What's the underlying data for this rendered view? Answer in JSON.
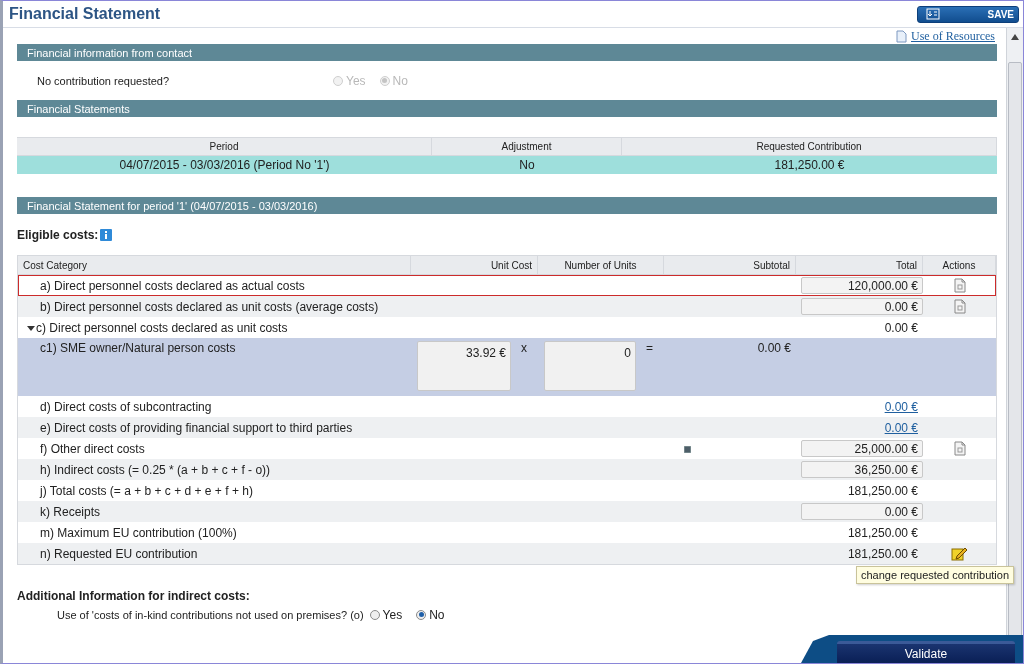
{
  "window": {
    "title": "Financial Statement"
  },
  "save_button": "SAVE",
  "resources_link": "Use of Resources",
  "contact_section": {
    "title": "Financial information from contact",
    "question": "No contribution requested?",
    "disabled": true,
    "options": [
      {
        "label": "Yes",
        "selected": false
      },
      {
        "label": "No",
        "selected": true
      }
    ]
  },
  "statements_section": {
    "title": "Financial Statements",
    "columns": [
      "Period",
      "Adjustment",
      "Requested Contribution"
    ],
    "rows": [
      {
        "cells": [
          "04/07/2015 - 03/03/2016 (Period No '1')",
          "No",
          "181,250.00 €"
        ],
        "selected": true
      }
    ]
  },
  "period_section": {
    "title": "Financial Statement for period '1' (04/07/2015 - 03/03/2016)",
    "eligible_label": "Eligible costs:"
  },
  "cost_table": {
    "columns": [
      "Cost Category",
      "Unit Cost",
      "Number of Units",
      "Subtotal",
      "Total",
      "Actions"
    ],
    "rows": [
      {
        "kind": "item",
        "label": "a) Direct personnel costs declared as actual costs",
        "total": {
          "kind": "field",
          "value": "120,000.00 €"
        },
        "action": {
          "kind": "document"
        },
        "highlighted": true
      },
      {
        "kind": "item",
        "label": "b) Direct personnel costs declared as unit costs (average costs)",
        "total": {
          "kind": "field",
          "value": "0.00 €"
        },
        "action": {
          "kind": "document"
        },
        "highlighted": false
      },
      {
        "kind": "group",
        "label": "c) Direct personnel costs declared as unit costs",
        "expanded": true,
        "total": {
          "kind": "text",
          "value": "0.00 €"
        }
      },
      {
        "kind": "unit",
        "label": "c1) SME owner/Natural person costs",
        "unit_cost": "33.92 €",
        "times": "x",
        "units": "0",
        "equals": "=",
        "subtotal": "0.00 €"
      },
      {
        "kind": "item",
        "label": "d) Direct costs of subcontracting",
        "total": {
          "kind": "link",
          "value": "0.00 €"
        },
        "highlighted": false
      },
      {
        "kind": "item",
        "label": "e) Direct costs of providing financial support to third parties",
        "total": {
          "kind": "link",
          "value": "0.00 €"
        },
        "highlighted": false
      },
      {
        "kind": "item",
        "label": "f) Other direct costs",
        "marker": true,
        "total": {
          "kind": "field",
          "value": "25,000.00 €"
        },
        "action": {
          "kind": "document"
        },
        "highlighted": false
      },
      {
        "kind": "item",
        "label": "h) Indirect costs (= 0.25 * (a + b + c + f - o))",
        "total": {
          "kind": "field",
          "value": "36,250.00 €"
        },
        "highlighted": false
      },
      {
        "kind": "item",
        "label": "j) Total costs (= a + b + c + d + e + f + h)",
        "total": {
          "kind": "text",
          "value": "181,250.00 €"
        },
        "highlighted": false
      },
      {
        "kind": "item",
        "label": "k) Receipts",
        "total": {
          "kind": "field",
          "value": "0.00 €"
        },
        "highlighted": false
      },
      {
        "kind": "item",
        "label": "m) Maximum EU contribution (100%)",
        "total": {
          "kind": "text",
          "value": "181,250.00 €"
        },
        "highlighted": false
      },
      {
        "kind": "item",
        "label": "n) Requested EU contribution",
        "total": {
          "kind": "text",
          "value": "181,250.00 €"
        },
        "action": {
          "kind": "edit"
        },
        "tooltip": "change requested contribution",
        "highlighted": false
      }
    ]
  },
  "additional": {
    "title": "Additional Information for indirect costs:",
    "question": "Use of 'costs of in-kind contributions not used on premises? (o)",
    "disabled": false,
    "options": [
      {
        "label": "Yes",
        "selected": false
      },
      {
        "label": "No",
        "selected": true
      }
    ]
  },
  "validate_button": "Validate"
}
